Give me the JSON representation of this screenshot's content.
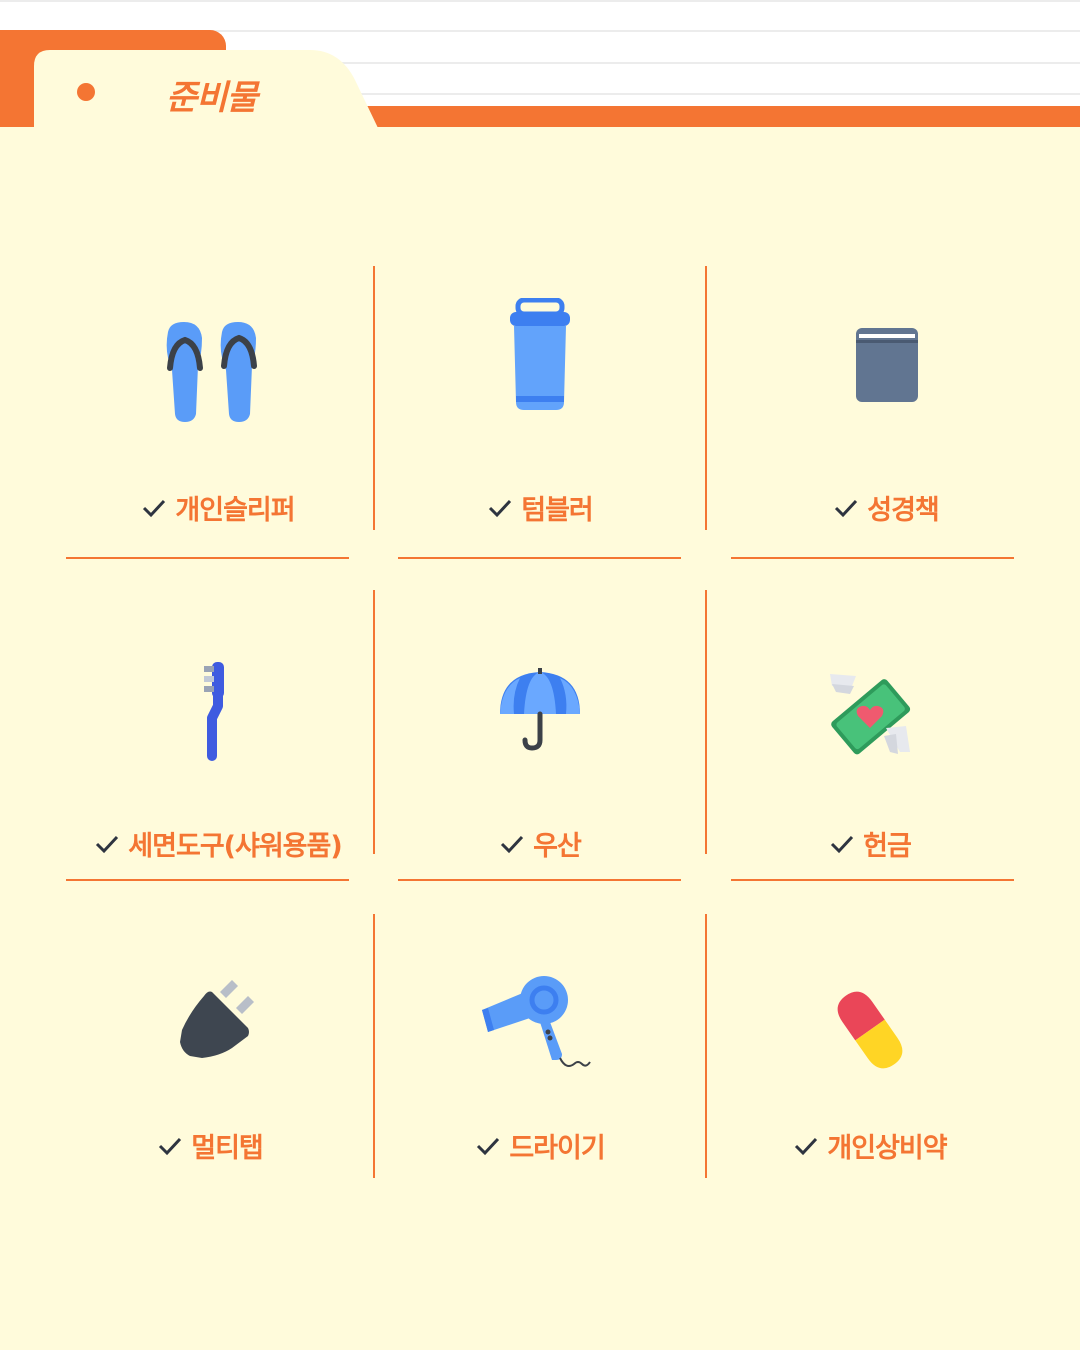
{
  "header": {
    "tab_title": "준비물"
  },
  "colors": {
    "accent": "#f47533",
    "background": "#fffbdb",
    "check": "#2e3440"
  },
  "items": [
    {
      "label": "개인슬리퍼",
      "icon": "slippers-icon"
    },
    {
      "label": "텀블러",
      "icon": "tumbler-icon"
    },
    {
      "label": "성경책",
      "icon": "bible-book-icon"
    },
    {
      "label": "세면도구(샤워용품)",
      "icon": "toothbrush-icon"
    },
    {
      "label": "우산",
      "icon": "umbrella-icon"
    },
    {
      "label": "헌금",
      "icon": "money-with-wings-icon"
    },
    {
      "label": "멀티탭",
      "icon": "plug-icon"
    },
    {
      "label": "드라이기",
      "icon": "hair-dryer-icon"
    },
    {
      "label": "개인상비약",
      "icon": "pill-icon"
    }
  ]
}
